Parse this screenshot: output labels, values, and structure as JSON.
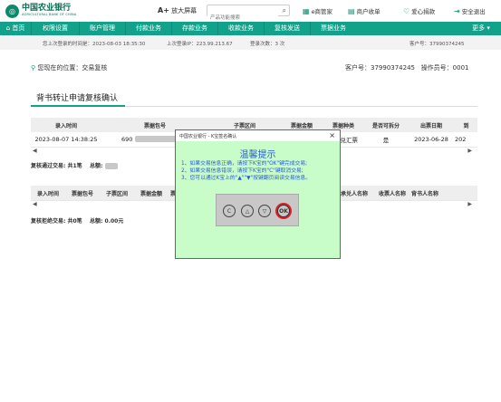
{
  "header": {
    "logo_cn": "中国农业银行",
    "logo_en": "AGRICULTURAL BANK OF CHINA",
    "font_zoom_a": "A+",
    "font_zoom_label": "放大屏幕",
    "search_placeholder": "产品功能搜索",
    "links": [
      {
        "label": "e商管家",
        "icon": "store-icon"
      },
      {
        "label": "商户收单",
        "icon": "merchant-icon"
      },
      {
        "label": "爱心捐款",
        "icon": "donate-icon"
      },
      {
        "label": "安全退出",
        "icon": "logout-icon"
      }
    ]
  },
  "nav": {
    "items": [
      "首页",
      "权限设置",
      "账户管理",
      "付款业务",
      "存款业务",
      "收款业务",
      "复核发送",
      "票据业务"
    ],
    "more": "更多"
  },
  "infoline": {
    "last_login_time": "您上次登录的时间是：2023-08-03 18:35:30",
    "last_login_ip": "上次登录IP：223.99.213.67",
    "login_count": "登录次数：3 次",
    "customer_no": "客户号：37990374245"
  },
  "location": {
    "label": "您现在的位置：交易复核",
    "customer": "客户号：37990374245",
    "operator": "操作员号：0001"
  },
  "page_title": "背书转让申请复核确认",
  "table1": {
    "headers": [
      "录入时间",
      "票据包号",
      "子票区间",
      "票据金额",
      "票据种类",
      "是否可拆分",
      "出票日期",
      "到"
    ],
    "row": {
      "time": "2023-08-07 14:38:25",
      "pkg": "690",
      "type": "商业承兑汇票",
      "split": "是",
      "date": "2023-06-28",
      "extra": "202"
    },
    "summary": "复核通过交易: 共1笔",
    "total_label": "总额:"
  },
  "table2": {
    "headers": [
      "录入时间",
      "票据包号",
      "子票区间",
      "票据金额",
      "票",
      "",
      "",
      "",
      "",
      "",
      "承兑人名称",
      "收票人名称",
      "背书人名称"
    ],
    "summary": "复核拒绝交易: 共0笔",
    "total": "总额: 0.00元"
  },
  "dialog": {
    "title": "中国农业银行 - K宝签名确认",
    "heading": "温馨提示",
    "lines": [
      "1、如果交易信息正确，请按下K宝的\"OK\"键完成交易;",
      "2、如果交易信息错误，请按下K宝的\"C\"键取消交易;",
      "3、您可以通过K宝上的\"▲\"\"▼\"按键翻页阅读交易信息。"
    ],
    "ok_label": "OK",
    "c_label": "C"
  }
}
